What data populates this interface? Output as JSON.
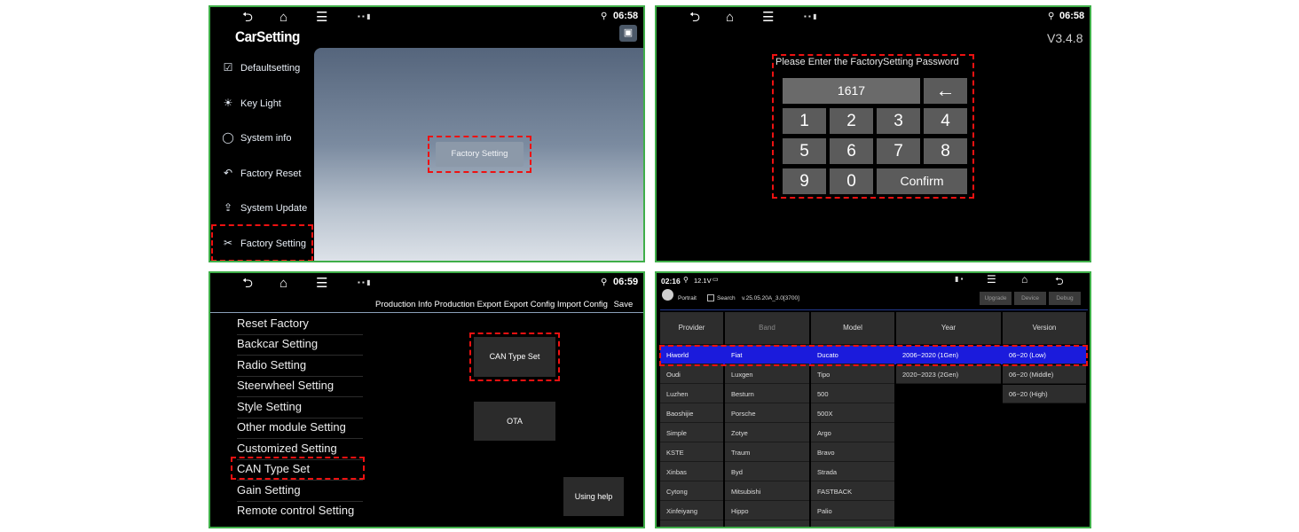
{
  "colors": {
    "highlight": "#e11111",
    "panel_border": "#3fae49",
    "row_selected": "#1b1bdc"
  },
  "p1": {
    "time": "06:58",
    "app_title": "CarSetting",
    "sidebar": [
      {
        "label": "Defaultsetting",
        "icon": "checkbox-icon"
      },
      {
        "label": "Key Light",
        "icon": "bulb-icon"
      },
      {
        "label": "System info",
        "icon": "chat-icon"
      },
      {
        "label": "Factory Reset",
        "icon": "reset-arrow-icon"
      },
      {
        "label": "System Update",
        "icon": "upload-icon"
      },
      {
        "label": "Factory Setting",
        "icon": "tools-icon"
      }
    ],
    "center_button": "Factory Setting"
  },
  "p2": {
    "time": "06:58",
    "version": "V3.4.8",
    "prompt": "Please Enter the FactorySetting Password",
    "password_value": "1617",
    "backspace": "←",
    "keys": [
      "1",
      "2",
      "3",
      "4",
      "5",
      "6",
      "7",
      "8",
      "9",
      "0"
    ],
    "confirm": "Confirm"
  },
  "p3": {
    "time": "06:59",
    "top_menu": [
      "Production Info",
      "Production Export",
      "Export Config",
      "Import Config",
      "Save"
    ],
    "menu": [
      "Reset Factory",
      "Backcar Setting",
      "Radio Setting",
      "Steerwheel Setting",
      "Style Setting",
      "Other module Setting",
      "Customized Setting",
      "CAN Type Set",
      "Gain Setting",
      "Remote control Setting"
    ],
    "can_type_button": "CAN Type Set",
    "ota_button": "OTA",
    "help_button": "Using help"
  },
  "p4": {
    "time": "02:16",
    "voltage": "12.1V",
    "portrait": "Portrait",
    "search": "Search",
    "build": "v.25.05.20A_3.0[3700]",
    "buttons": [
      "Upgrade",
      "Device",
      "Debug"
    ],
    "headers": [
      "Provider",
      "Band",
      "Model",
      "Year",
      "Version"
    ],
    "providers": [
      "Hiworld",
      "Oudi",
      "Luzhen",
      "Baoshijie",
      "Simple",
      "KSTE",
      "Xinbas",
      "Cytong",
      "Xinfeiyang"
    ],
    "bands": [
      "Fiat",
      "Luxgen",
      "Besturn",
      "Porsche",
      "Zotye",
      "Traum",
      "Byd",
      "Mitsubishi",
      "Hippo"
    ],
    "models": [
      "Ducato",
      "Tipo",
      "500",
      "500X",
      "Argo",
      "Bravo",
      "Strada",
      "FASTBACK",
      "Palio"
    ],
    "years": [
      "2006~2020 (1Gen)",
      "2020~2023 (2Gen)"
    ],
    "versions": [
      "06~20 (Low)",
      "06~20 (Middle)",
      "06~20 (High)"
    ]
  }
}
